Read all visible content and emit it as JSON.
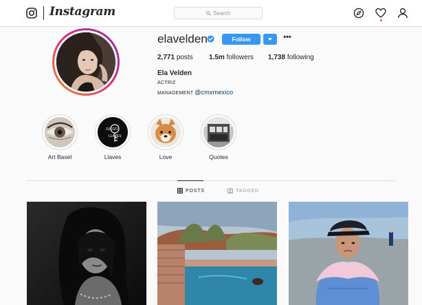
{
  "nav": {
    "wordmark": "Instagram",
    "search_placeholder": "Search",
    "icons": [
      "instagram-glyph-icon",
      "search-icon",
      "explore-compass-icon",
      "activity-heart-icon",
      "profile-icon"
    ],
    "notification_color": "#ed4956"
  },
  "profile": {
    "username": "elavelden",
    "verified": true,
    "follow_label": "Follow",
    "stats": {
      "posts_value": "2,771",
      "posts_label": "posts",
      "followers_value": "1.5m",
      "followers_label": "followers",
      "following_value": "1,738",
      "following_label": "following"
    },
    "full_name": "Ela Velden",
    "bio_line1": "ACTRIZ",
    "bio_line2_prefix": "MANAGEMENT",
    "bio_mention": "@cmxmexico"
  },
  "highlights": [
    {
      "label": "Art Basel"
    },
    {
      "label": "Llaves"
    },
    {
      "label": "Love"
    },
    {
      "label": "Quotes"
    }
  ],
  "tabs": {
    "posts_label": "POSTS",
    "tagged_label": "TAGGED",
    "active": "POSTS"
  },
  "colors": {
    "accent": "#3897f0",
    "text": "#262626",
    "border": "#dbdbdb",
    "background": "#fafafa",
    "mention": "#003569"
  }
}
